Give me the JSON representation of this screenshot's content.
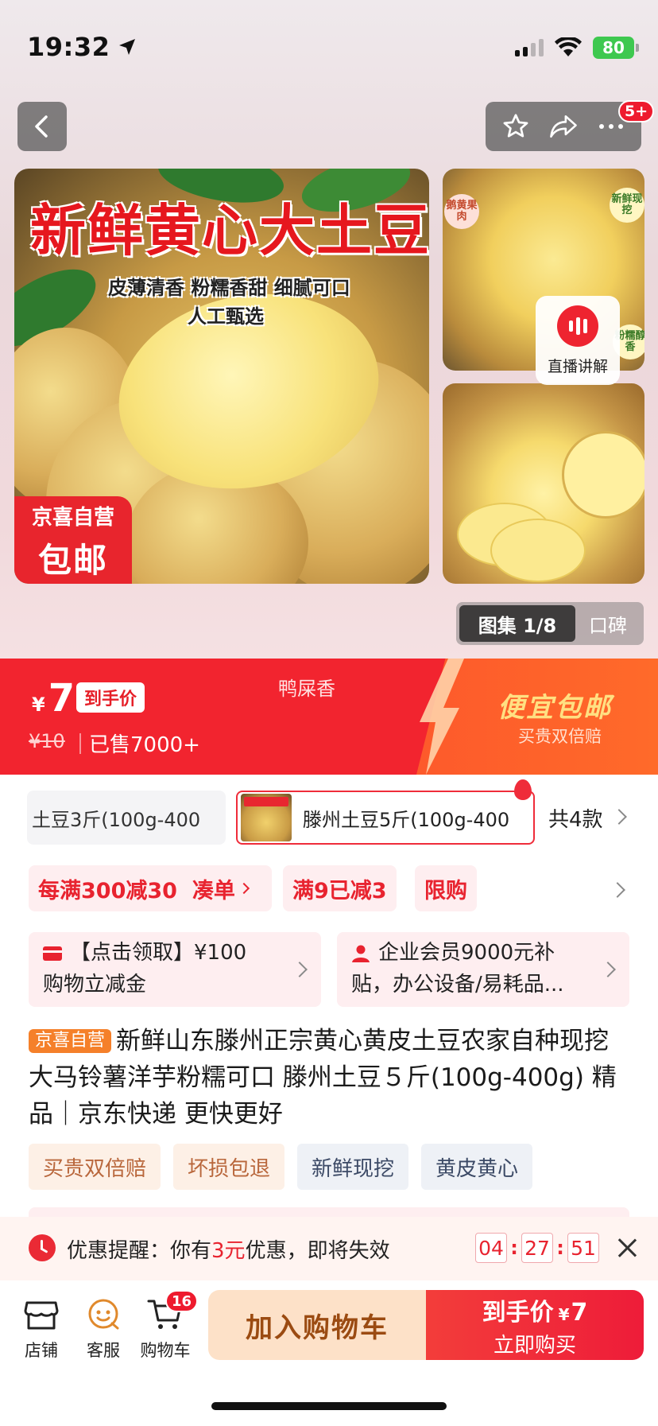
{
  "status_bar": {
    "time": "19:32",
    "battery": "80"
  },
  "nav": {
    "message_badge": "5+"
  },
  "gallery": {
    "main_title": "新鲜黄心大土豆",
    "main_subtitle_1": "皮薄清香 粉糯香甜 细腻可口",
    "main_subtitle_2": "人工甄选",
    "badge_line1": "京喜自营",
    "badge_line2": "包邮",
    "side_tag_1": "鹅黄果肉",
    "side_tag_2": "新鲜现挖",
    "side_tag_3": "粉糯醇香",
    "live_label": "直播讲解",
    "tab_active": "图集 1/8",
    "tab_other": "口碑"
  },
  "price": {
    "currency": "¥",
    "value": "7",
    "tag": "到手价",
    "original": "¥10",
    "sold": "已售7000+",
    "variant_name": "鸭屎香",
    "promo_big": "便宜包邮",
    "promo_small": "买贵双倍赔"
  },
  "variants": {
    "option_a": "土豆3斤(100g-400",
    "option_b": "滕州土豆5斤(100g-400",
    "count": "共4款"
  },
  "promos": {
    "chip1_text": "每满300减30",
    "chip1_action": "凑单",
    "chip2": "满9已减3",
    "chip3": "限购"
  },
  "coupons": {
    "card1_line1": "【点击领取】¥100",
    "card1_line2": "购物立减金",
    "card2_line1": "企业会员9000元补",
    "card2_line2": "贴，办公设备/易耗品..."
  },
  "product": {
    "tag": "京喜自营",
    "title": "新鲜山东滕州正宗黄心黄皮土豆农家自种现挖大马铃薯洋芋粉糯可口 滕州土豆５斤(100g-400g) 精品｜京东快递 更快更好"
  },
  "services": [
    "买贵双倍赔",
    "坏损包退",
    "新鲜现挖",
    "黄皮黄心"
  ],
  "reminder": {
    "prefix": "优惠提醒：你有",
    "amount": "3元",
    "suffix": "优惠，即将失效",
    "hh": "04",
    "mm": "27",
    "ss": "51"
  },
  "bottom_bar": {
    "store": "店铺",
    "service": "客服",
    "cart": "购物车",
    "cart_count": "16",
    "add_to_cart": "加入购物车",
    "buy_price_label": "到手价",
    "buy_currency": "¥",
    "buy_price": "7",
    "buy_now": "立即购买"
  },
  "colors": {
    "accent_red": "#f2242f",
    "promo_orange": "#fd5a2b",
    "jx_orange": "#f5802a"
  }
}
